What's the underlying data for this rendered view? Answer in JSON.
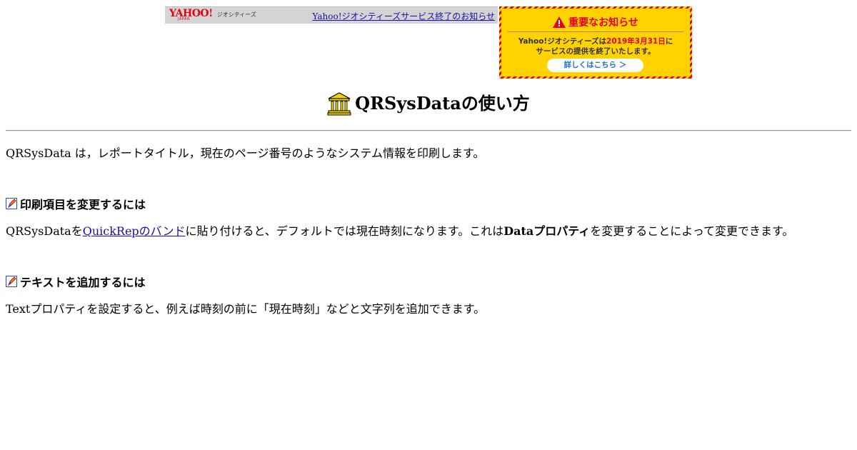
{
  "geocities_bar": {
    "logo_main": "YAHOO!",
    "logo_sub": "JAPAN",
    "service_name": "ジオシティーズ",
    "link_text": "Yahoo!ジオシティーズサービス終了のお知らせ"
  },
  "notice_banner": {
    "title": "重要なお知らせ",
    "line1_prefix": "Yahoo!ジオシティーズは",
    "line1_date": "2019年3月31日",
    "line1_suffix": "に",
    "line2": "サービスの提供を終了いたします。",
    "button_label": "詳しくはこちら ＞",
    "colors": {
      "red": "#e5001f",
      "yellow": "#ffd200"
    },
    "icon": "warning-icon"
  },
  "page": {
    "title_icon": "building-icon",
    "title": "QRSysDataの使い方",
    "intro": "QRSysData は，レポートタイトル，現在のページ番号のようなシステム情報を印刷します。",
    "sections": [
      {
        "icon": "pen-icon",
        "heading": "印刷項目を変更するには",
        "text_before": "QRSysDataを",
        "link": "QuickRepのバンド",
        "text_middle": "に貼り付けると、デフォルトでは現在時刻になります。これは",
        "bold": "Dataプロパティ",
        "text_after": "を変更することによって変更できます。"
      },
      {
        "icon": "pen-icon",
        "heading": "テキストを追加するには",
        "text": "Textプロパティを設定すると、例えば時刻の前に「現在時刻」などと文字列を追加できます。"
      }
    ]
  }
}
